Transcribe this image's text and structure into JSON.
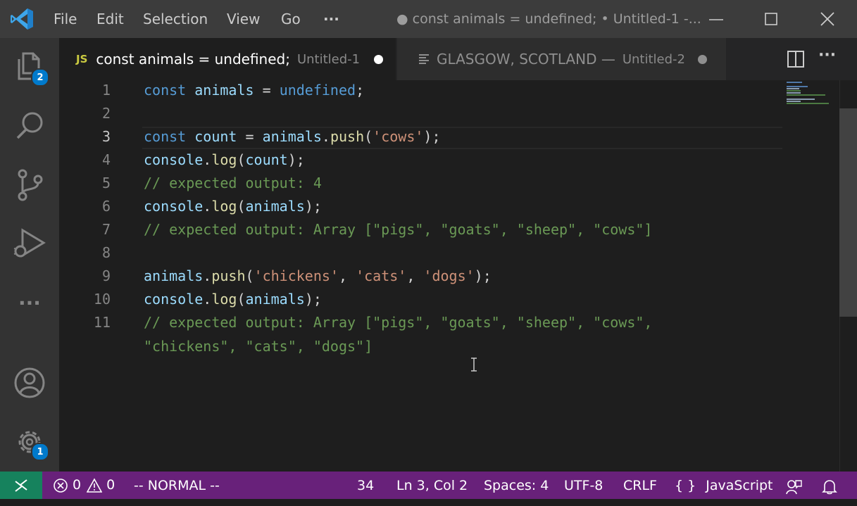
{
  "menu": {
    "file": "File",
    "edit": "Edit",
    "selection": "Selection",
    "view": "View",
    "go": "Go",
    "more": "···"
  },
  "window": {
    "title": "● const animals = undefined; • Untitled-1 -..."
  },
  "activity": {
    "explorer_badge": "2",
    "settings_badge": "1",
    "more": "···"
  },
  "tabs": [
    {
      "icon": "JS",
      "label": "const animals = undefined;",
      "description": "Untitled-1"
    },
    {
      "label": "GLASGOW, SCOTLAND —",
      "description": "Untitled-2"
    }
  ],
  "editor": {
    "line_numbers": [
      "1",
      "2",
      "3",
      "4",
      "5",
      "6",
      "7",
      "8",
      "9",
      "10",
      "11"
    ],
    "current_line": 3,
    "code": [
      [
        "const",
        " ",
        "animals",
        " = ",
        "undefined",
        ";"
      ],
      [],
      [
        "const",
        " ",
        "count",
        " = ",
        "animals",
        ".",
        "push",
        "(",
        "'cows'",
        ");"
      ],
      [
        "console",
        ".",
        "log",
        "(",
        "count",
        ");"
      ],
      [
        "// expected output: 4"
      ],
      [
        "console",
        ".",
        "log",
        "(",
        "animals",
        ");"
      ],
      [
        "// expected output: Array [\"pigs\", \"goats\", \"sheep\", \"cows\"]"
      ],
      [],
      [
        "animals",
        ".",
        "push",
        "(",
        "'chickens'",
        ", ",
        "'cats'",
        ", ",
        "'dogs'",
        ");"
      ],
      [
        "console",
        ".",
        "log",
        "(",
        "animals",
        ");"
      ],
      [
        "// expected output: Array [\"pigs\", \"goats\", \"sheep\", \"cows\","
      ],
      [
        "\"chickens\", \"cats\", \"dogs\"]"
      ]
    ]
  },
  "status": {
    "errors": "0",
    "warnings": "0",
    "mode": "-- NORMAL --",
    "count": "34",
    "position": "Ln 3, Col 2",
    "spaces": "Spaces: 4",
    "encoding": "UTF-8",
    "eol": "CRLF",
    "language_icon": "{ }",
    "language": "JavaScript"
  },
  "colors": {
    "statusbar": "#68217a",
    "remote": "#16825d",
    "keyword": "#569cd6",
    "variable": "#9cdcfe",
    "function": "#dcdcaa",
    "string": "#ce9178",
    "comment": "#6a9955",
    "badge": "#007acc"
  }
}
